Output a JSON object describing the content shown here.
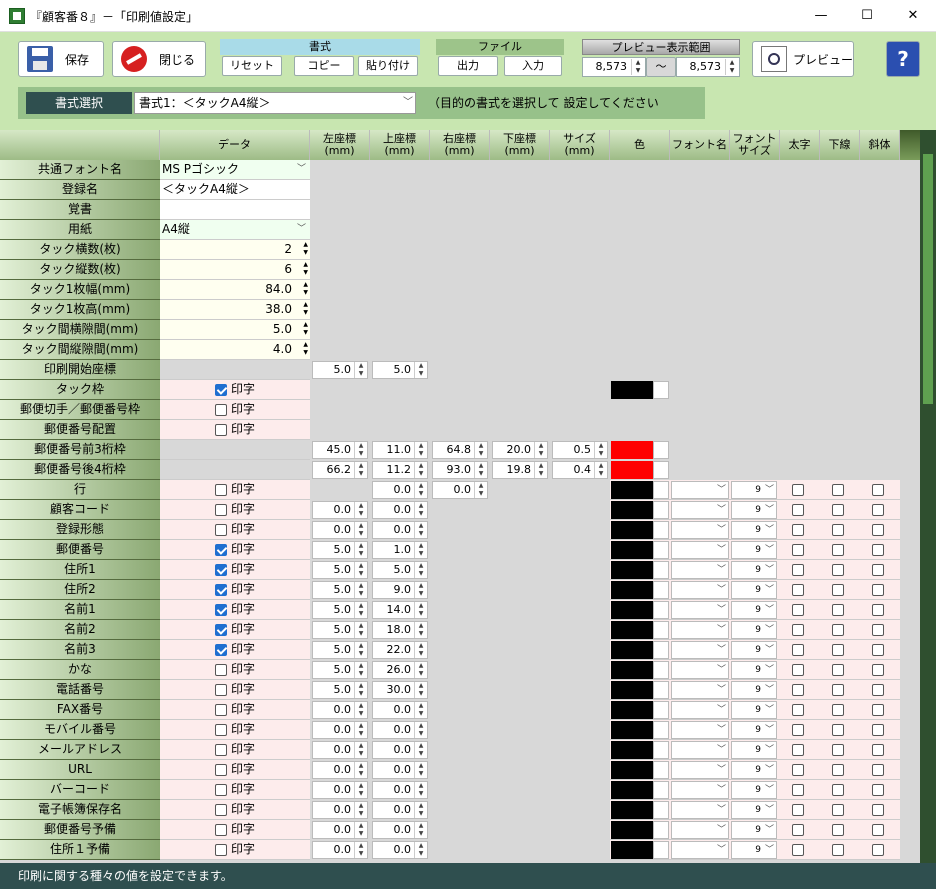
{
  "window": {
    "title": "『顧客番８』－「印刷値設定」",
    "minimize": "—",
    "maximize": "☐",
    "close": "✕"
  },
  "toolbar": {
    "save_label": "保存",
    "close_label": "閉じる",
    "format_group": "書式",
    "reset": "リセット",
    "copy": "コピー",
    "paste": "貼り付け",
    "file_group": "ファイル",
    "export": "出力",
    "import": "入力",
    "preview_range_label": "プレビュー表示範囲",
    "range_from": "8,573",
    "range_sep": "～",
    "range_to": "8,573",
    "preview_label": "プレビュー",
    "help": "?"
  },
  "format_select": {
    "label": "書式選択",
    "value": "書式1：＜タックA4縦＞",
    "hint": "（目的の書式を選択して 設定してください"
  },
  "headers": [
    "データ",
    "左座標\n(mm)",
    "上座標\n(mm)",
    "右座標\n(mm)",
    "下座標\n(mm)",
    "サイズ\n(mm)",
    "色",
    "フォント名",
    "フォント\nサイズ",
    "太字",
    "下線",
    "斜体"
  ],
  "print_label": "印字",
  "rows": [
    {
      "label": "共通フォント名",
      "data": "MS Pゴシック",
      "kind": "select"
    },
    {
      "label": "登録名",
      "data": "＜タックA4縦＞",
      "kind": "text"
    },
    {
      "label": "覚書",
      "data": "",
      "kind": "text"
    },
    {
      "label": "用紙",
      "data": "A4縦",
      "kind": "select"
    },
    {
      "label": "タック横数(枚)",
      "data": "2",
      "kind": "num"
    },
    {
      "label": "タック縦数(枚)",
      "data": "6",
      "kind": "num"
    },
    {
      "label": "タック1枚幅(mm)",
      "data": "84.0",
      "kind": "num"
    },
    {
      "label": "タック1枚高(mm)",
      "data": "38.0",
      "kind": "num"
    },
    {
      "label": "タック間横隙間(mm)",
      "data": "5.0",
      "kind": "num"
    },
    {
      "label": "タック間縦隙間(mm)",
      "data": "4.0",
      "kind": "num"
    },
    {
      "label": "印刷開始座標",
      "left": "5.0",
      "top": "5.0",
      "kind": "coord"
    },
    {
      "label": "タック枠",
      "print": true,
      "color": "#000000",
      "kind": "frame"
    },
    {
      "label": "郵便切手／郵便番号枠",
      "print": false,
      "kind": "check"
    },
    {
      "label": "郵便番号配置",
      "print": false,
      "kind": "check"
    },
    {
      "label": "郵便番号前3桁枠",
      "left": "45.0",
      "top": "11.0",
      "right": "64.8",
      "bottom": "20.0",
      "size": "0.5",
      "color": "#ff0000",
      "kind": "box"
    },
    {
      "label": "郵便番号後4桁枠",
      "left": "66.2",
      "top": "11.2",
      "right": "93.0",
      "bottom": "19.8",
      "size": "0.4",
      "color": "#ff0000",
      "kind": "box"
    },
    {
      "label": "行",
      "print": false,
      "top": "0.0",
      "right": "0.0",
      "fsize": "9",
      "kind": "line"
    },
    {
      "label": "顧客コード",
      "print": false,
      "left": "0.0",
      "top": "0.0",
      "fsize": "9",
      "kind": "field"
    },
    {
      "label": "登録形態",
      "print": false,
      "left": "0.0",
      "top": "0.0",
      "fsize": "9",
      "kind": "field"
    },
    {
      "label": "郵便番号",
      "print": true,
      "left": "5.0",
      "top": "1.0",
      "fsize": "9",
      "kind": "field"
    },
    {
      "label": "住所1",
      "print": true,
      "left": "5.0",
      "top": "5.0",
      "fsize": "9",
      "kind": "field"
    },
    {
      "label": "住所2",
      "print": true,
      "left": "5.0",
      "top": "9.0",
      "fsize": "9",
      "kind": "field"
    },
    {
      "label": "名前1",
      "print": true,
      "left": "5.0",
      "top": "14.0",
      "fsize": "9",
      "kind": "field"
    },
    {
      "label": "名前2",
      "print": true,
      "left": "5.0",
      "top": "18.0",
      "fsize": "9",
      "kind": "field"
    },
    {
      "label": "名前3",
      "print": true,
      "left": "5.0",
      "top": "22.0",
      "fsize": "9",
      "kind": "field"
    },
    {
      "label": "かな",
      "print": false,
      "left": "5.0",
      "top": "26.0",
      "fsize": "9",
      "kind": "field"
    },
    {
      "label": "電話番号",
      "print": false,
      "left": "5.0",
      "top": "30.0",
      "fsize": "9",
      "kind": "field"
    },
    {
      "label": "FAX番号",
      "print": false,
      "left": "0.0",
      "top": "0.0",
      "fsize": "9",
      "kind": "field"
    },
    {
      "label": "モバイル番号",
      "print": false,
      "left": "0.0",
      "top": "0.0",
      "fsize": "9",
      "kind": "field"
    },
    {
      "label": "メールアドレス",
      "print": false,
      "left": "0.0",
      "top": "0.0",
      "fsize": "9",
      "kind": "field"
    },
    {
      "label": "URL",
      "print": false,
      "left": "0.0",
      "top": "0.0",
      "fsize": "9",
      "kind": "field"
    },
    {
      "label": "バーコード",
      "print": false,
      "left": "0.0",
      "top": "0.0",
      "fsize": "9",
      "kind": "field"
    },
    {
      "label": "電子帳簿保存名",
      "print": false,
      "left": "0.0",
      "top": "0.0",
      "fsize": "9",
      "kind": "field"
    },
    {
      "label": "郵便番号予備",
      "print": false,
      "left": "0.0",
      "top": "0.0",
      "fsize": "9",
      "kind": "field"
    },
    {
      "label": "住所１予備",
      "print": false,
      "left": "0.0",
      "top": "0.0",
      "fsize": "9",
      "kind": "field"
    }
  ],
  "status": "印刷に関する種々の値を設定できます。"
}
